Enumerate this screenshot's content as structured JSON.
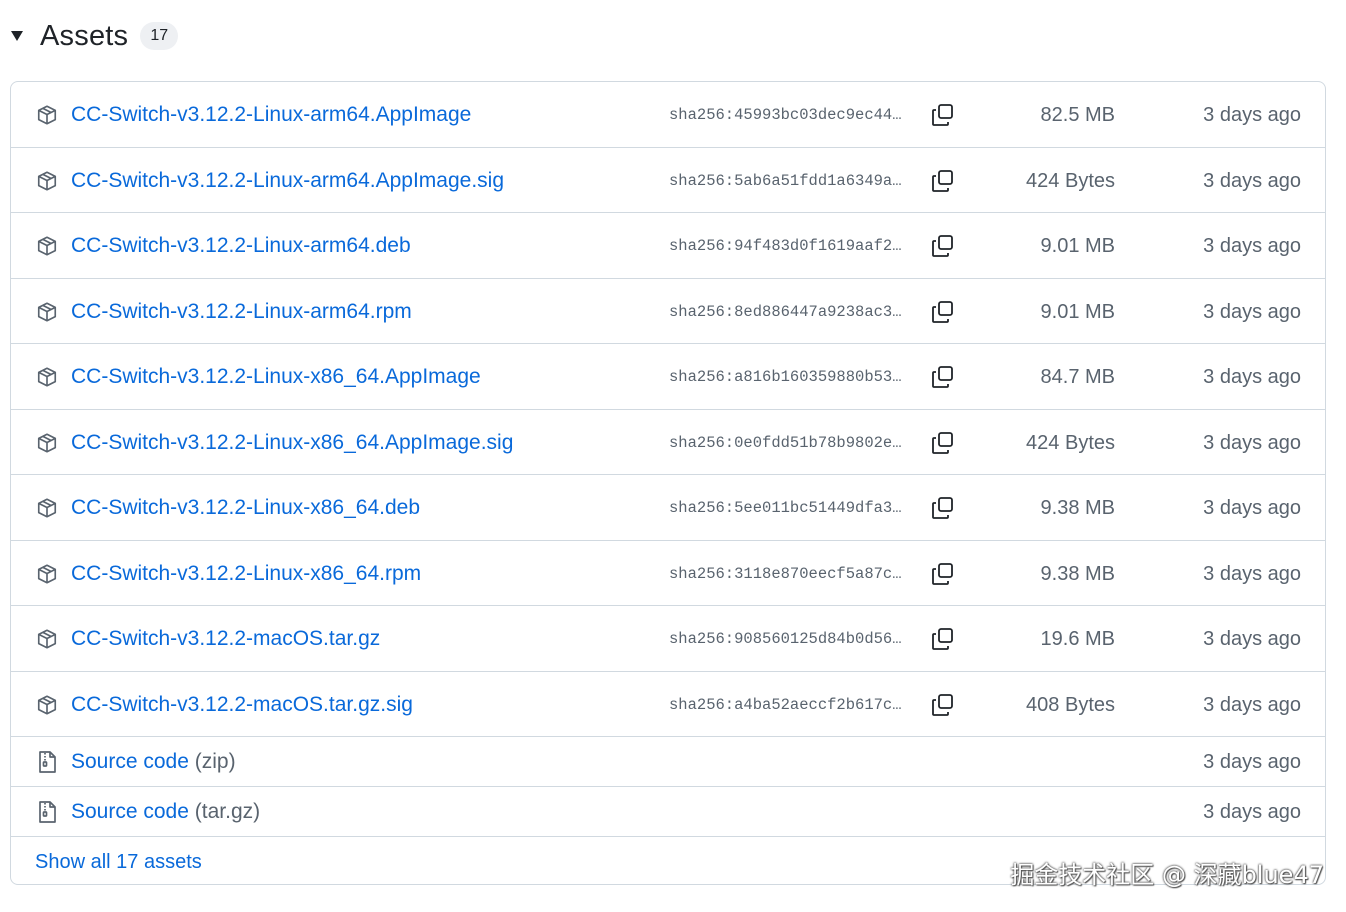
{
  "header": {
    "title": "Assets",
    "count": "17"
  },
  "assets": [
    {
      "name": "CC-Switch-v3.12.2-Linux-arm64.AppImage",
      "sha": "sha256:45993bc03dec9ec44…",
      "size": "82.5 MB",
      "date": "3 days ago"
    },
    {
      "name": "CC-Switch-v3.12.2-Linux-arm64.AppImage.sig",
      "sha": "sha256:5ab6a51fdd1a6349a…",
      "size": "424 Bytes",
      "date": "3 days ago"
    },
    {
      "name": "CC-Switch-v3.12.2-Linux-arm64.deb",
      "sha": "sha256:94f483d0f1619aaf2…",
      "size": "9.01 MB",
      "date": "3 days ago"
    },
    {
      "name": "CC-Switch-v3.12.2-Linux-arm64.rpm",
      "sha": "sha256:8ed886447a9238ac3…",
      "size": "9.01 MB",
      "date": "3 days ago"
    },
    {
      "name": "CC-Switch-v3.12.2-Linux-x86_64.AppImage",
      "sha": "sha256:a816b160359880b53…",
      "size": "84.7 MB",
      "date": "3 days ago"
    },
    {
      "name": "CC-Switch-v3.12.2-Linux-x86_64.AppImage.sig",
      "sha": "sha256:0e0fdd51b78b9802e…",
      "size": "424 Bytes",
      "date": "3 days ago"
    },
    {
      "name": "CC-Switch-v3.12.2-Linux-x86_64.deb",
      "sha": "sha256:5ee011bc51449dfa3…",
      "size": "9.38 MB",
      "date": "3 days ago"
    },
    {
      "name": "CC-Switch-v3.12.2-Linux-x86_64.rpm",
      "sha": "sha256:3118e870eecf5a87c…",
      "size": "9.38 MB",
      "date": "3 days ago"
    },
    {
      "name": "CC-Switch-v3.12.2-macOS.tar.gz",
      "sha": "sha256:908560125d84b0d56…",
      "size": "19.6 MB",
      "date": "3 days ago"
    },
    {
      "name": "CC-Switch-v3.12.2-macOS.tar.gz.sig",
      "sha": "sha256:a4ba52aeccf2b617c…",
      "size": "408 Bytes",
      "date": "3 days ago"
    }
  ],
  "sources": [
    {
      "label": "Source code",
      "format": "(zip)",
      "date": "3 days ago"
    },
    {
      "label": "Source code",
      "format": "(tar.gz)",
      "date": "3 days ago"
    }
  ],
  "footer": {
    "show_all": "Show all 17 assets"
  },
  "watermark": "掘金技术社区 @ 深藏blue47",
  "icons": {
    "caret": "triangle-down-icon",
    "asset": "package-icon",
    "source": "file-zip-icon",
    "copy": "copy-icon"
  },
  "colors": {
    "link": "#0969da",
    "muted": "#59636e",
    "border": "#d1d9e0",
    "badge_bg": "#eef0f3"
  }
}
